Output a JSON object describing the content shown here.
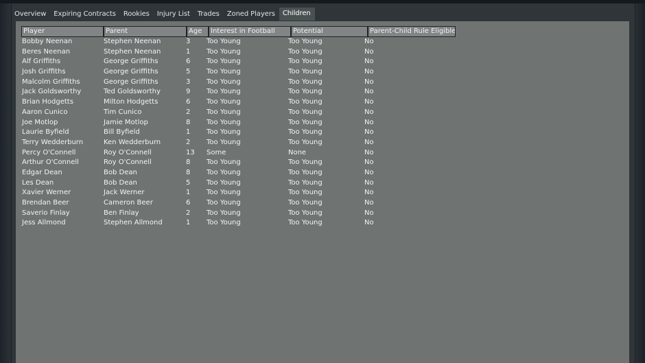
{
  "tabs": [
    {
      "label": "Overview",
      "active": false
    },
    {
      "label": "Expiring Contracts",
      "active": false
    },
    {
      "label": "Rookies",
      "active": false
    },
    {
      "label": "Injury List",
      "active": false
    },
    {
      "label": "Trades",
      "active": false
    },
    {
      "label": "Zoned Players",
      "active": false
    },
    {
      "label": "Children",
      "active": true
    }
  ],
  "table": {
    "headers": {
      "player": "Player",
      "parent": "Parent",
      "age": "Age",
      "interest": "Interest in Football",
      "potential": "Potential",
      "eligible": "Parent-Child Rule Eligible?"
    },
    "rows": [
      {
        "player": "Bobby Neenan",
        "parent": "Stephen Neenan",
        "age": "3",
        "interest": "Too Young",
        "potential": "Too Young",
        "eligible": "No"
      },
      {
        "player": "Beres Neenan",
        "parent": "Stephen Neenan",
        "age": "1",
        "interest": "Too Young",
        "potential": "Too Young",
        "eligible": "No"
      },
      {
        "player": "Alf Griffiths",
        "parent": "George Griffiths",
        "age": "6",
        "interest": "Too Young",
        "potential": "Too Young",
        "eligible": "No"
      },
      {
        "player": "Josh Griffiths",
        "parent": "George Griffiths",
        "age": "5",
        "interest": "Too Young",
        "potential": "Too Young",
        "eligible": "No"
      },
      {
        "player": "Malcolm Griffiths",
        "parent": "George Griffiths",
        "age": "3",
        "interest": "Too Young",
        "potential": "Too Young",
        "eligible": "No"
      },
      {
        "player": "Jack Goldsworthy",
        "parent": "Ted Goldsworthy",
        "age": "9",
        "interest": "Too Young",
        "potential": "Too Young",
        "eligible": "No"
      },
      {
        "player": "Brian Hodgetts",
        "parent": "Milton Hodgetts",
        "age": "6",
        "interest": "Too Young",
        "potential": "Too Young",
        "eligible": "No"
      },
      {
        "player": "Aaron Cunico",
        "parent": "Tim Cunico",
        "age": "2",
        "interest": "Too Young",
        "potential": "Too Young",
        "eligible": "No"
      },
      {
        "player": "Joe Motlop",
        "parent": "Jamie Motlop",
        "age": "8",
        "interest": "Too Young",
        "potential": "Too Young",
        "eligible": "No"
      },
      {
        "player": "Laurie Byfield",
        "parent": "Bill Byfield",
        "age": "1",
        "interest": "Too Young",
        "potential": "Too Young",
        "eligible": "No"
      },
      {
        "player": "Terry Wedderburn",
        "parent": "Ken Wedderburn",
        "age": "2",
        "interest": "Too Young",
        "potential": "Too Young",
        "eligible": "No"
      },
      {
        "player": "Percy O'Connell",
        "parent": "Roy O'Connell",
        "age": "13",
        "interest": "Some",
        "potential": "None",
        "eligible": "No"
      },
      {
        "player": "Arthur O'Connell",
        "parent": "Roy O'Connell",
        "age": "8",
        "interest": "Too Young",
        "potential": "Too Young",
        "eligible": "No"
      },
      {
        "player": "Edgar Dean",
        "parent": "Bob Dean",
        "age": "8",
        "interest": "Too Young",
        "potential": "Too Young",
        "eligible": "No"
      },
      {
        "player": "Les Dean",
        "parent": "Bob Dean",
        "age": "5",
        "interest": "Too Young",
        "potential": "Too Young",
        "eligible": "No"
      },
      {
        "player": "Xavier Werner",
        "parent": "Jack Werner",
        "age": "1",
        "interest": "Too Young",
        "potential": "Too Young",
        "eligible": "No"
      },
      {
        "player": "Brendan Beer",
        "parent": "Cameron Beer",
        "age": "6",
        "interest": "Too Young",
        "potential": "Too Young",
        "eligible": "No"
      },
      {
        "player": "Saverio Finlay",
        "parent": "Ben Finlay",
        "age": "2",
        "interest": "Too Young",
        "potential": "Too Young",
        "eligible": "No"
      },
      {
        "player": "Jess Allmond",
        "parent": "Stephen Allmond",
        "age": "1",
        "interest": "Too Young",
        "potential": "Too Young",
        "eligible": "No"
      }
    ]
  }
}
